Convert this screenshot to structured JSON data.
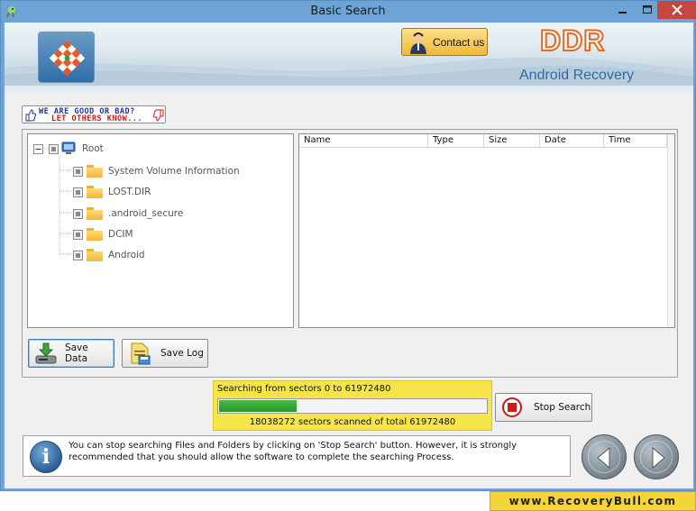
{
  "window": {
    "title": "Basic Search",
    "app_icon": "app-bird-icon"
  },
  "header": {
    "contact_label": "Contact us",
    "brand": "DDR",
    "product": "Android Recovery",
    "brand_color": "#e56a1c",
    "product_color": "#2f6aa8"
  },
  "feedback": {
    "line1": "WE ARE GOOD OR BAD?",
    "line2": "LET OTHERS KNOW..."
  },
  "tree": {
    "root": "Root",
    "items": [
      {
        "label": "System Volume Information"
      },
      {
        "label": "LOST.DIR"
      },
      {
        "label": ".android_secure"
      },
      {
        "label": "DCIM"
      },
      {
        "label": "Android"
      }
    ]
  },
  "file_list": {
    "columns": [
      "Name",
      "Type",
      "Size",
      "Date",
      "Time"
    ]
  },
  "actions": {
    "save_data": "Save Data",
    "save_log": "Save Log",
    "stop_search": "Stop Search"
  },
  "progress": {
    "range_text": "Searching from sectors 0 to 61972480",
    "scanned_text": "18038272  sectors scanned of total 61972480",
    "fraction": 0.291,
    "box_color": "#f5e54b",
    "bar_color": "#27962a"
  },
  "info": {
    "message": "You can stop searching Files and Folders by clicking on 'Stop Search' button. However, it is strongly recommended that you should allow the software to complete the searching Process."
  },
  "footer": {
    "site": "www.RecoveryBull.com"
  }
}
